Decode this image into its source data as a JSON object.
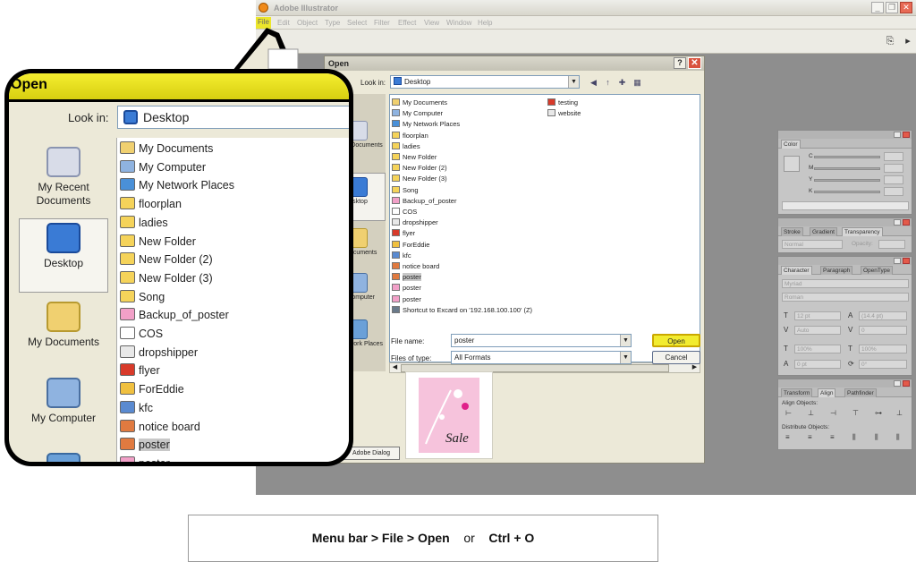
{
  "app": {
    "title": "Adobe Illustrator",
    "menu": [
      "File",
      "Edit",
      "Object",
      "Type",
      "Select",
      "Filter",
      "Effect",
      "View",
      "Window",
      "Help"
    ]
  },
  "dialog": {
    "title": "Open",
    "help_btn": "?",
    "close_btn": "✕",
    "look_in_label": "Look in:",
    "look_in_value": "Desktop",
    "places": [
      "Recent\nDocuments",
      "Desktop",
      "My\nDocuments",
      "My\nComputer",
      "My Network\nPlaces"
    ],
    "files": [
      {
        "name": "My Documents",
        "icon": "documents-folder-icon",
        "selected": false
      },
      {
        "name": "My Computer",
        "icon": "computer-icon",
        "selected": false
      },
      {
        "name": "My Network Places",
        "icon": "network-icon",
        "selected": false
      },
      {
        "name": "floorplan",
        "icon": "folder-icon",
        "selected": false
      },
      {
        "name": "ladies",
        "icon": "folder-icon",
        "selected": false
      },
      {
        "name": "New Folder",
        "icon": "folder-icon",
        "selected": false
      },
      {
        "name": "New Folder (2)",
        "icon": "folder-icon",
        "selected": false
      },
      {
        "name": "New Folder (3)",
        "icon": "folder-icon",
        "selected": false
      },
      {
        "name": "Song",
        "icon": "folder-icon",
        "selected": false
      },
      {
        "name": "Backup_of_poster",
        "icon": "ai-file-icon",
        "selected": false
      },
      {
        "name": "COS",
        "icon": "shortcut-icon",
        "selected": false
      },
      {
        "name": "dropshipper",
        "icon": "document-icon",
        "selected": false
      },
      {
        "name": "flyer",
        "icon": "pdf-icon",
        "selected": false
      },
      {
        "name": "ForEddie",
        "icon": "cd-icon",
        "selected": false
      },
      {
        "name": "kfc",
        "icon": "app-icon",
        "selected": false
      },
      {
        "name": "notice board",
        "icon": "image-icon",
        "selected": false
      },
      {
        "name": "poster",
        "icon": "image-icon",
        "selected": true
      },
      {
        "name": "poster",
        "icon": "ai-file-icon",
        "selected": false
      },
      {
        "name": "poster",
        "icon": "ai-file-icon",
        "selected": false
      },
      {
        "name": "Shortcut to Excard on '192.168.100.100' (Z)",
        "icon": "network-drive-icon",
        "selected": false
      }
    ],
    "files_col2": [
      {
        "name": "testing",
        "icon": "pdf-icon"
      },
      {
        "name": "website",
        "icon": "document-icon"
      }
    ],
    "file_name_label": "File name:",
    "file_name_value": "poster",
    "files_of_type_label": "Files of type:",
    "files_of_type_value": "All Formats",
    "open_btn": "Open",
    "cancel_btn": "Cancel",
    "adobe_dialog_btn": "Adobe Dialog",
    "preview_text": "Sale"
  },
  "palettes": {
    "color": {
      "tab": "Color",
      "fields": [
        "C",
        "M",
        "Y",
        "K"
      ]
    },
    "transparency": {
      "tabs": [
        "Stroke",
        "Gradient",
        "Transparency"
      ],
      "mode": "Normal",
      "opacity_label": "Opacity:"
    },
    "character": {
      "tabs": [
        "Character",
        "Paragraph",
        "OpenType"
      ],
      "font": "Myriad",
      "style": "Roman",
      "values": [
        "12 pt",
        "(14.4 pt)",
        "Auto",
        "0",
        "100%",
        "100%",
        "0 pt",
        "0°"
      ]
    },
    "align": {
      "tabs": [
        "Transform",
        "Align",
        "Pathfinder"
      ],
      "align_objects": "Align Objects:",
      "distribute_objects": "Distribute Objects:"
    }
  },
  "callout": {
    "title": "Open",
    "look_in_label": "Look in:",
    "look_in_value": "Desktop",
    "places": [
      {
        "label": "My Recent\nDocuments",
        "icon": "recent-documents-icon"
      },
      {
        "label": "Desktop",
        "icon": "desktop-icon"
      },
      {
        "label": "My Documents",
        "icon": "my-documents-icon"
      },
      {
        "label": "My Computer",
        "icon": "my-computer-icon"
      }
    ],
    "files": [
      "My Documents",
      "My Computer",
      "My Network Places",
      "floorplan",
      "ladies",
      "New Folder",
      "New Folder (2)",
      "New Folder (3)",
      "Song",
      "Backup_of_poster",
      "COS",
      "dropshipper",
      "flyer",
      "ForEddie",
      "kfc",
      "notice board",
      "poster",
      "poster"
    ]
  },
  "caption": {
    "part1": "Menu bar > File > Open",
    "or": "or",
    "part2": "Ctrl + O"
  },
  "colors": {
    "highlight_yellow": "#f2ec30",
    "workspace_gray": "#8e8e8e",
    "dialog_bg": "#ece9d8"
  }
}
